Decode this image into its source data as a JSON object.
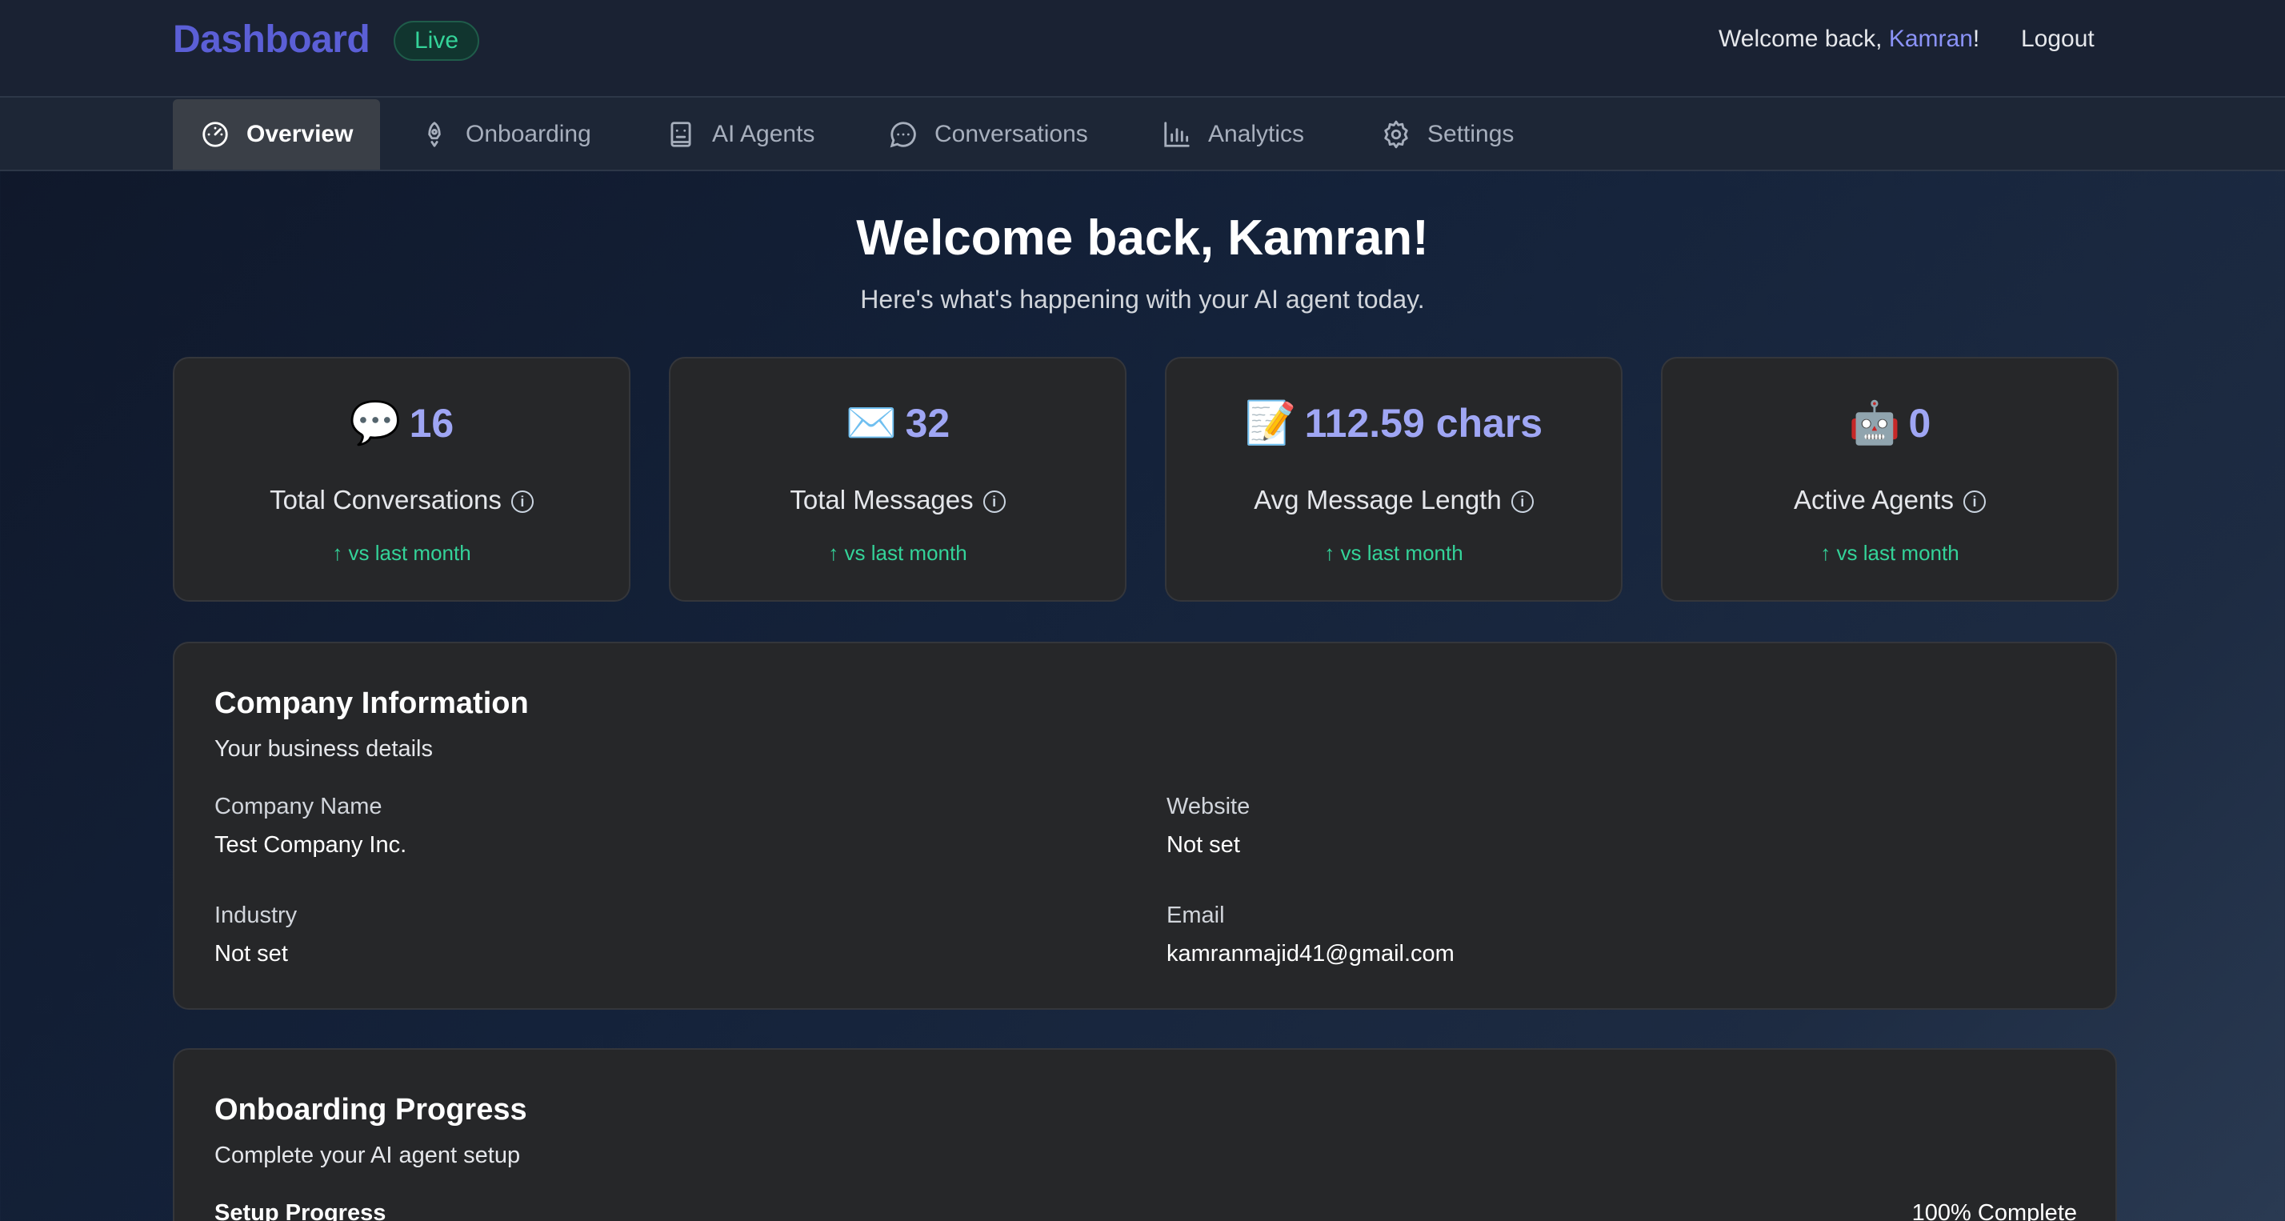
{
  "header": {
    "brand": "Dashboard",
    "status_badge": "Live",
    "welcome_prefix": "Welcome back, ",
    "username": "Kamran",
    "welcome_suffix": "!",
    "logout_label": "Logout"
  },
  "nav": {
    "tabs": [
      {
        "label": "Overview",
        "icon": "gauge-icon",
        "active": true
      },
      {
        "label": "Onboarding",
        "icon": "rocket-icon",
        "active": false
      },
      {
        "label": "AI Agents",
        "icon": "bot-icon",
        "active": false
      },
      {
        "label": "Conversations",
        "icon": "chat-bubble-icon",
        "active": false
      },
      {
        "label": "Analytics",
        "icon": "bar-chart-icon",
        "active": false
      },
      {
        "label": "Settings",
        "icon": "gear-icon",
        "active": false
      }
    ]
  },
  "hero": {
    "title": "Welcome back, Kamran!",
    "subtitle": "Here's what's happening with your AI agent today."
  },
  "stats": [
    {
      "emoji": "💬",
      "value": "16",
      "label": "Total Conversations",
      "trend": "↑ vs last month"
    },
    {
      "emoji": "✉️",
      "value": "32",
      "label": "Total Messages",
      "trend": "↑ vs last month"
    },
    {
      "emoji": "📝",
      "value": "112.59 chars",
      "label": "Avg Message Length",
      "trend": "↑ vs last month"
    },
    {
      "emoji": "🤖",
      "value": "0",
      "label": "Active Agents",
      "trend": "↑ vs last month"
    }
  ],
  "company": {
    "title": "Company Information",
    "subtitle": "Your business details",
    "fields": {
      "company_name": {
        "label": "Company Name",
        "value": "Test Company Inc."
      },
      "website": {
        "label": "Website",
        "value": "Not set"
      },
      "industry": {
        "label": "Industry",
        "value": "Not set"
      },
      "email": {
        "label": "Email",
        "value": "kamranmajid41@gmail.com"
      }
    }
  },
  "onboarding": {
    "title": "Onboarding Progress",
    "subtitle": "Complete your AI agent setup",
    "progress_label": "Setup Progress",
    "progress_text": "100% Complete",
    "progress_fraction": 1.0
  },
  "colors": {
    "accent": "#9fa6f4",
    "brand": "#5b5fd6",
    "positive": "#34d399",
    "card_bg": "#262729"
  }
}
